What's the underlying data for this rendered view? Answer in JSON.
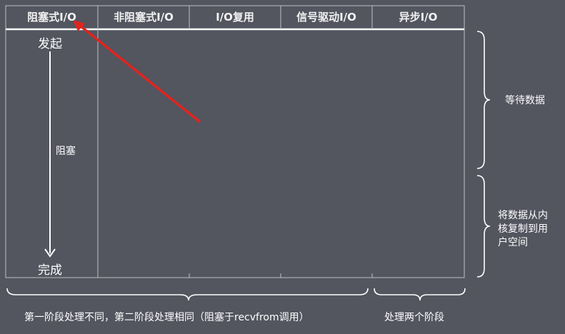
{
  "headers": {
    "col1": "阻塞式I/O",
    "col2": "非阻塞式I/O",
    "col3": "I/O复用",
    "col4": "信号驱动I/O",
    "col5": "异步I/O"
  },
  "blocking_flow": {
    "start": "发起",
    "middle": "阻塞",
    "end": "完成"
  },
  "right_labels": {
    "phase1": "等待数据",
    "phase2_line1": "将数据从内",
    "phase2_line2": "核复制到用",
    "phase2_line3": "户空间"
  },
  "bottom_labels": {
    "left": "第一阶段处理不同，第二阶段处理相同（阻塞于recvfrom调用）",
    "right": "处理两个阶段"
  },
  "colors": {
    "background": "#53555f",
    "lines": "#c8c8cc",
    "arrow_annotation": "#e0241f"
  }
}
